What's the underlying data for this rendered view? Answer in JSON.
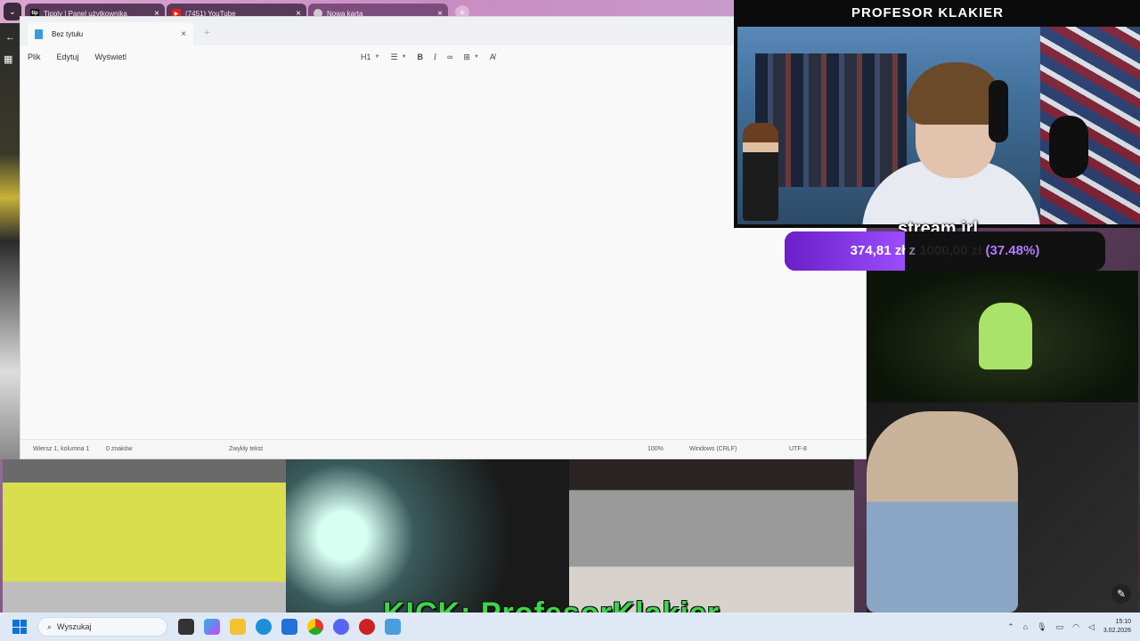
{
  "browser": {
    "tabs": [
      {
        "label": "Tipply | Panel użytkownika",
        "favicon": "tip"
      },
      {
        "label": "(7451) YouTube",
        "favicon": "youtube-icon"
      },
      {
        "label": "Nowa karta",
        "favicon": "chrome-icon"
      }
    ]
  },
  "notepad": {
    "tab_title": "Bez tytułu",
    "menu": [
      "Plik",
      "Edytuj",
      "Wyświetl"
    ],
    "heading_label": "H1",
    "status": {
      "position": "Wiersz 1, kolumna 1",
      "chars": "0 znaków",
      "format": "Zwykły tekst",
      "zoom": "100%",
      "line_ending": "Windows (CRLF)",
      "encoding": "UTF-8"
    }
  },
  "stream": {
    "channel_title": "PROFESOR KLAKIER",
    "goal_label": "stream irl",
    "goal_current": "374,81 zł",
    "goal_separator": "z",
    "goal_target": "1000,00 zł",
    "goal_percent": "(37.48%)",
    "goal_fraction": 0.3748,
    "kick_banner": "KICK: ProfesorKlakier"
  },
  "taskbar": {
    "search_placeholder": "Wyszukaj",
    "time": "15:10",
    "date": "3.02.2026"
  },
  "colors": {
    "goal_fill": "#8a3dea",
    "kick_green": "#3dd64a",
    "taskbar": "#dfe9f5"
  }
}
